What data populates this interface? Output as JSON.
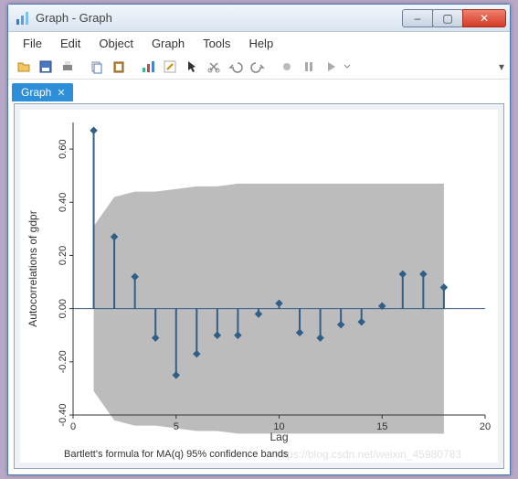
{
  "window": {
    "title": "Graph - Graph",
    "buttons": {
      "min": "–",
      "max": "▢",
      "close": "✕"
    }
  },
  "menu": {
    "items": [
      "File",
      "Edit",
      "Object",
      "Graph",
      "Tools",
      "Help"
    ]
  },
  "toolbar": {
    "icons": [
      "open-icon",
      "save-icon",
      "print-icon",
      "copy-icon",
      "paste-icon",
      "chart-icon",
      "edit-chart-icon",
      "pointer-icon",
      "cut-icon",
      "undo-icon",
      "redo-icon",
      "record-icon",
      "pause-icon",
      "play-icon"
    ]
  },
  "tab": {
    "label": "Graph",
    "close": "✕"
  },
  "chart_data": {
    "type": "ac-plot",
    "title": "",
    "xlabel": "Lag",
    "ylabel": "Autocorrelations of gdpr",
    "footnote": "Bartlett's formula for MA(q) 95% confidence bands",
    "xlim": [
      0,
      20
    ],
    "ylim": [
      -0.4,
      0.7
    ],
    "xticks": [
      0,
      5,
      10,
      15,
      20
    ],
    "yticks": [
      -0.4,
      -0.2,
      0.0,
      0.2,
      0.4,
      0.6
    ],
    "lags": [
      1,
      2,
      3,
      4,
      5,
      6,
      7,
      8,
      9,
      10,
      11,
      12,
      13,
      14,
      15,
      16,
      17,
      18
    ],
    "values": [
      0.67,
      0.27,
      0.12,
      -0.11,
      -0.25,
      -0.17,
      -0.1,
      -0.1,
      -0.02,
      0.02,
      -0.09,
      -0.11,
      -0.06,
      -0.05,
      0.01,
      0.13,
      0.13,
      0.08
    ],
    "band_upper": [
      0.31,
      0.42,
      0.44,
      0.44,
      0.45,
      0.46,
      0.46,
      0.47,
      0.47,
      0.47,
      0.47,
      0.47,
      0.47,
      0.47,
      0.47,
      0.47,
      0.47,
      0.47
    ],
    "band_lower": [
      -0.31,
      -0.42,
      -0.44,
      -0.44,
      -0.45,
      -0.46,
      -0.46,
      -0.47,
      -0.47,
      -0.47,
      -0.47,
      -0.47,
      -0.47,
      -0.47,
      -0.47,
      -0.47,
      -0.47,
      -0.47
    ],
    "colors": {
      "series": "#2f5e87",
      "band": "#b0b0b0",
      "axis": "#333333"
    }
  }
}
